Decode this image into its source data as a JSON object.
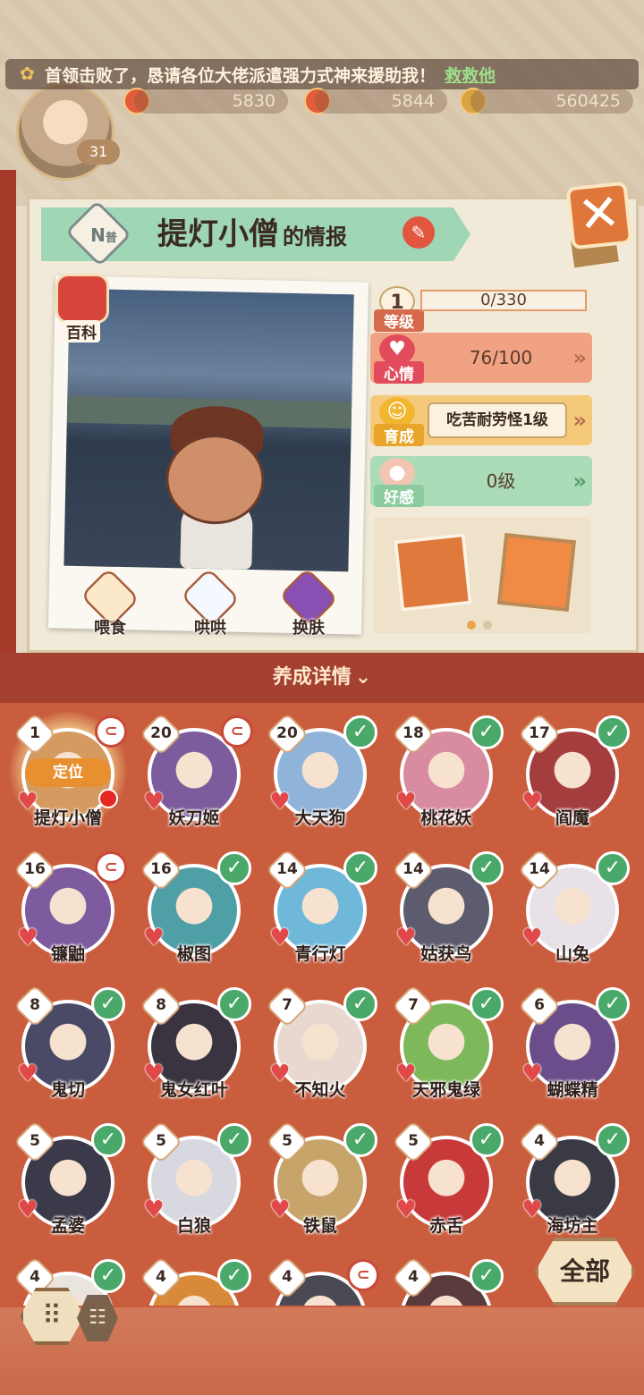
{
  "notice": {
    "text": "首领击败了，恳请各位大佬派遣强力式神来援助我！",
    "help_link": "救救他"
  },
  "player": {
    "level": "31"
  },
  "currencies": [
    "5830",
    "5844",
    "560425"
  ],
  "shikigami": {
    "rarity": "N",
    "rarity_sub": "普",
    "name": "提灯小僧",
    "name_suffix": "的情报"
  },
  "encyclopedia_label": "百科",
  "actions": [
    {
      "label": "喂食",
      "icon": "bowl-icon"
    },
    {
      "label": "哄哄",
      "icon": "milk-icon"
    },
    {
      "label": "换肤",
      "icon": "kimono-icon"
    }
  ],
  "stats": {
    "level": {
      "label": "等级",
      "badge": "1",
      "value": "0/330"
    },
    "mood": {
      "label": "心情",
      "value": "76/100"
    },
    "training": {
      "label": "育成",
      "value": "吃苦耐劳怪1级"
    },
    "favor": {
      "label": "好感",
      "value": "0级"
    }
  },
  "panel_title": "养成详情",
  "locate_label": "定位",
  "roster": [
    {
      "level": "1",
      "name": "提灯小僧",
      "status": "locked",
      "current": true,
      "color": "#d49a5f"
    },
    {
      "level": "20",
      "name": "妖刀姬",
      "status": "locked",
      "current": false,
      "color": "#7c5c9c"
    },
    {
      "level": "20",
      "name": "大天狗",
      "status": "done",
      "current": false,
      "color": "#8fb3d9"
    },
    {
      "level": "18",
      "name": "桃花妖",
      "status": "done",
      "current": false,
      "color": "#d88ba1"
    },
    {
      "level": "17",
      "name": "阎魔",
      "status": "done",
      "current": false,
      "color": "#a43d3d"
    },
    {
      "level": "16",
      "name": "镰鼬",
      "status": "locked",
      "current": false,
      "color": "#7e5a9e"
    },
    {
      "level": "16",
      "name": "椒图",
      "status": "done",
      "current": false,
      "color": "#4f9fa6"
    },
    {
      "level": "14",
      "name": "青行灯",
      "status": "done",
      "current": false,
      "color": "#6fb8d9"
    },
    {
      "level": "14",
      "name": "姑获鸟",
      "status": "done",
      "current": false,
      "color": "#5c5c6e"
    },
    {
      "level": "14",
      "name": "山兔",
      "status": "done",
      "current": false,
      "color": "#e8e2e8"
    },
    {
      "level": "8",
      "name": "鬼切",
      "status": "done",
      "current": false,
      "color": "#4a4a66"
    },
    {
      "level": "8",
      "name": "鬼女红叶",
      "status": "done",
      "current": false,
      "color": "#3a3340"
    },
    {
      "level": "7",
      "name": "不知火",
      "status": "done",
      "current": false,
      "color": "#e8d8d0"
    },
    {
      "level": "7",
      "name": "天邪鬼绿",
      "status": "done",
      "current": false,
      "color": "#7db85a"
    },
    {
      "level": "6",
      "name": "蝴蝶精",
      "status": "done",
      "current": false,
      "color": "#6a4d8a"
    },
    {
      "level": "5",
      "name": "孟婆",
      "status": "done",
      "current": false,
      "color": "#3a3a4a"
    },
    {
      "level": "5",
      "name": "白狼",
      "status": "done",
      "current": false,
      "color": "#d8d8e0"
    },
    {
      "level": "5",
      "name": "铁鼠",
      "status": "done",
      "current": false,
      "color": "#c7a56a"
    },
    {
      "level": "5",
      "name": "赤舌",
      "status": "done",
      "current": false,
      "color": "#c83a3a"
    },
    {
      "level": "4",
      "name": "海坊主",
      "status": "done",
      "current": false,
      "color": "#3a3a44"
    },
    {
      "level": "4",
      "name": "",
      "status": "done",
      "current": false,
      "color": "#e9e4de"
    },
    {
      "level": "4",
      "name": "",
      "status": "done",
      "current": false,
      "color": "#d88a3a"
    },
    {
      "level": "4",
      "name": "",
      "status": "locked",
      "current": false,
      "color": "#4a4a55"
    },
    {
      "level": "4",
      "name": "",
      "status": "done",
      "current": false,
      "color": "#5a3a3a"
    }
  ],
  "all_button": "全部"
}
